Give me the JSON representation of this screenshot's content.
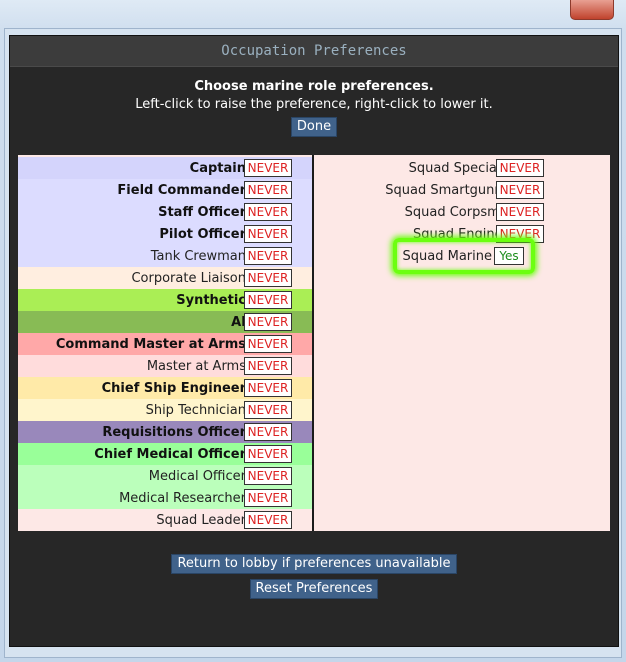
{
  "window": {
    "title": "Occupation Preferences"
  },
  "heading": "Choose marine role preferences.",
  "instructions": "Left-click to raise the preference, right-click to lower it.",
  "done_label": "Done",
  "left_roles": [
    {
      "name": "Captain",
      "bold": true,
      "bg": "#d4d4fc",
      "pref": "NEVER"
    },
    {
      "name": "Field Commander",
      "bold": true,
      "bg": "#dcdcff",
      "pref": "NEVER"
    },
    {
      "name": "Staff Officer",
      "bold": true,
      "bg": "#dcdcff",
      "pref": "NEVER"
    },
    {
      "name": "Pilot Officer",
      "bold": true,
      "bg": "#dcdcff",
      "pref": "NEVER"
    },
    {
      "name": "Tank Crewman",
      "bold": false,
      "bg": "#dcdcff",
      "pref": "NEVER"
    },
    {
      "name": "Corporate Liaison",
      "bold": false,
      "bg": "#ffeee0",
      "pref": "NEVER"
    },
    {
      "name": "Synthetic",
      "bold": true,
      "bg": "#aaee55",
      "pref": "NEVER"
    },
    {
      "name": "AI",
      "bold": true,
      "bg": "#88bb55",
      "pref": "NEVER"
    },
    {
      "name": "Command Master at Arms",
      "bold": true,
      "bg": "#ffa8a8",
      "pref": "NEVER"
    },
    {
      "name": "Master at Arms",
      "bold": false,
      "bg": "#ffdcdc",
      "pref": "NEVER"
    },
    {
      "name": "Chief Ship Engineer",
      "bold": true,
      "bg": "#ffeaa8",
      "pref": "NEVER"
    },
    {
      "name": "Ship Technician",
      "bold": false,
      "bg": "#fff5cc",
      "pref": "NEVER"
    },
    {
      "name": "Requisitions Officer",
      "bold": true,
      "bg": "#9988bb",
      "pref": "NEVER"
    },
    {
      "name": "Chief Medical Officer",
      "bold": true,
      "bg": "#99ff99",
      "pref": "NEVER"
    },
    {
      "name": "Medical Officer",
      "bold": false,
      "bg": "#bbffbb",
      "pref": "NEVER"
    },
    {
      "name": "Medical Researcher",
      "bold": false,
      "bg": "#bbffbb",
      "pref": "NEVER"
    },
    {
      "name": "Squad Leader",
      "bold": false,
      "bg": "#fde8e6",
      "pref": "NEVER"
    }
  ],
  "right_roles": [
    {
      "name": "Squad Specialist",
      "pref": "NEVER"
    },
    {
      "name": "Squad Smartgunner",
      "pref": "NEVER"
    },
    {
      "name": "Squad Corpsman",
      "pref": "NEVER"
    },
    {
      "name": "Squad Engineer",
      "pref": "NEVER"
    },
    {
      "name": "Squad Marine",
      "pref": "Yes",
      "highlight": true
    }
  ],
  "return_label": "Return to lobby if preferences unavailable",
  "reset_label": "Reset Preferences",
  "colors": {
    "never": "#dd2222",
    "yes": "#1a8c1a",
    "highlight": "#6cff10",
    "button": "#40628a"
  }
}
